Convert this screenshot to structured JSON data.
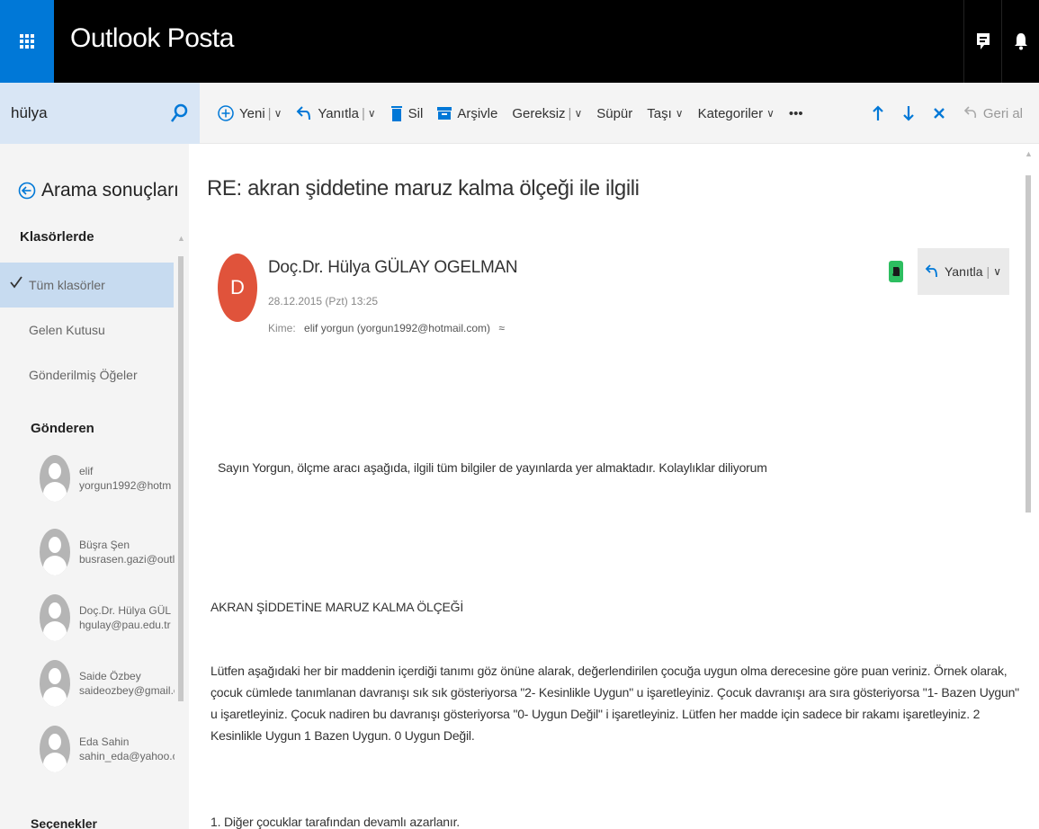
{
  "app": {
    "title": "Outlook Posta"
  },
  "search": {
    "value": "hülya"
  },
  "commands": {
    "new": "Yeni",
    "reply": "Yanıtla",
    "delete": "Sil",
    "archive": "Arşivle",
    "junk": "Gereksiz",
    "sweep": "Süpür",
    "move": "Taşı",
    "categories": "Kategoriler",
    "more": "•••",
    "undo": "Geri al"
  },
  "sidebar": {
    "back_label": "Arama sonuçları",
    "folders_heading": "Klasörlerde",
    "folders": [
      {
        "label": "Tüm klasörler",
        "selected": true
      },
      {
        "label": "Gelen Kutusu",
        "selected": false
      },
      {
        "label": "Gönderilmiş Öğeler",
        "selected": false
      }
    ],
    "senders_heading": "Gönderen",
    "senders": [
      {
        "name": "elif",
        "email": "yorgun1992@hotm"
      },
      {
        "name": "Büşra Şen",
        "email": "busrasen.gazi@outl"
      },
      {
        "name": "Doç.Dr. Hülya GÜL",
        "email": "hgulay@pau.edu.tr"
      },
      {
        "name": "Saide Özbey",
        "email": "saideozbey@gmail.c"
      },
      {
        "name": "Eda Sahin",
        "email": "sahin_eda@yahoo.c"
      }
    ],
    "options_heading": "Seçenekler"
  },
  "message": {
    "subject": "RE: akran şiddetine maruz kalma ölçeği ile ilgili",
    "avatar_initial": "D",
    "avatar_color": "#e0533b",
    "from": "Doç.Dr. Hülya GÜLAY OGELMAN",
    "date": "28.12.2015 (Pzt) 13:25",
    "to_label": "Kime:",
    "to": "elif yorgun (yorgun1992@hotmail.com)",
    "reply_button": "Yanıtla",
    "body": {
      "greeting": "Sayın Yorgun, ölçme aracı aşağıda, ilgili tüm bilgiler de yayınlarda yer almaktadır. Kolaylıklar diliyorum",
      "scale_title": "AKRAN ŞİDDETİNE MARUZ KALMA ÖLÇEĞİ",
      "instructions": "Lütfen aşağıdaki her bir maddenin içerdiği tanımı göz önüne alarak, değerlendirilen çocuğa uygun olma derecesine göre puan veriniz. Örnek olarak, çocuk cümlede tanımlanan davranışı sık sık gösteriyorsa \"2- Kesinlikle Uygun\" u işaretleyiniz. Çocuk davranışı ara sıra gösteriyorsa \"1- Bazen Uygun\" u işaretleyiniz. Çocuk nadiren bu davranışı gösteriyorsa \"0- Uygun Değil\" i işaretleyiniz. Lütfen her madde için sadece bir rakamı işaretleyiniz. 2 Kesinlikle Uygun 1 Bazen Uygun. 0 Uygun Değil.",
      "item1": "1. Diğer çocuklar tarafından devamlı azarlanır."
    }
  }
}
